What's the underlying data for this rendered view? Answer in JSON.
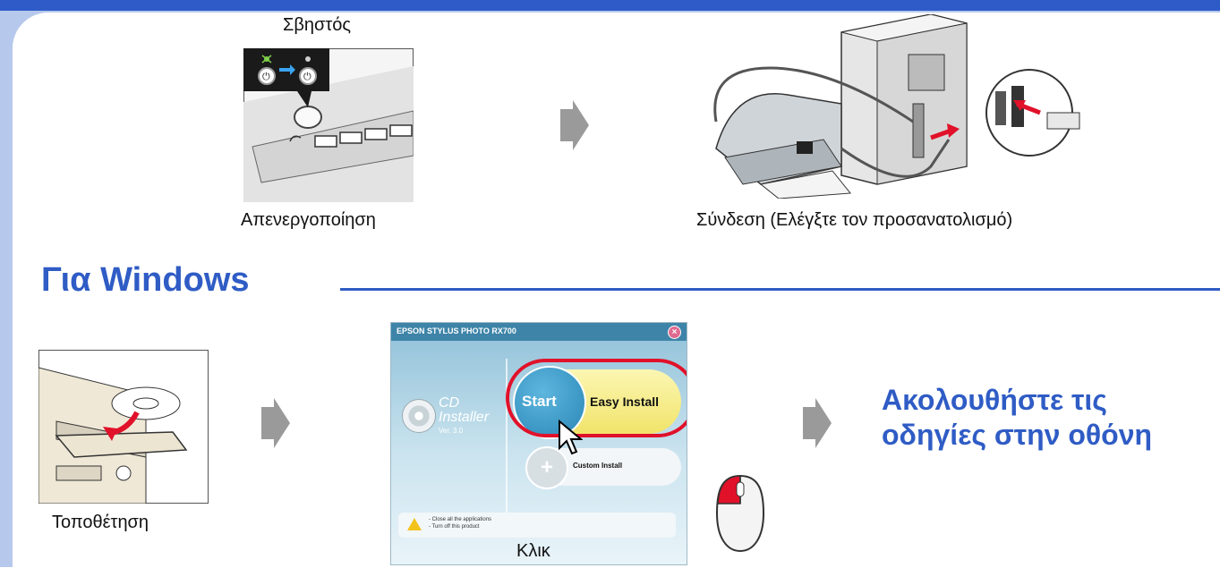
{
  "top": {
    "off_state_label": "Σβηστός",
    "power_off_caption": "Απενεργοποίηση",
    "connect_caption": "Σύνδεση (Ελέγξτε τον προσανατολισμό)"
  },
  "windows_section": {
    "title": "Για Windows",
    "insert_caption": "Τοποθέτηση",
    "click_caption": "Κλικ",
    "follow_line1": "Ακολουθήστε τις",
    "follow_line2": "οδηγίες στην οθόνη"
  },
  "installer": {
    "window_title": "EPSON STYLUS PHOTO RX700",
    "close_glyph": "×",
    "cd_label": "CD",
    "installer_label": "Installer",
    "version": "Ver. 3.0",
    "start_label": "Start",
    "easy_install_label": "Easy Install",
    "custom_glyph": "+",
    "custom_install_label": "Custom Install",
    "notice_line1": "- Close all the applications",
    "notice_line2": "- Turn off this product"
  },
  "colors": {
    "frame": "#b6c9ec",
    "accent_blue": "#2f5cc5",
    "arrow_gray": "#9a9a9a",
    "highlight_red": "#e1112a"
  }
}
